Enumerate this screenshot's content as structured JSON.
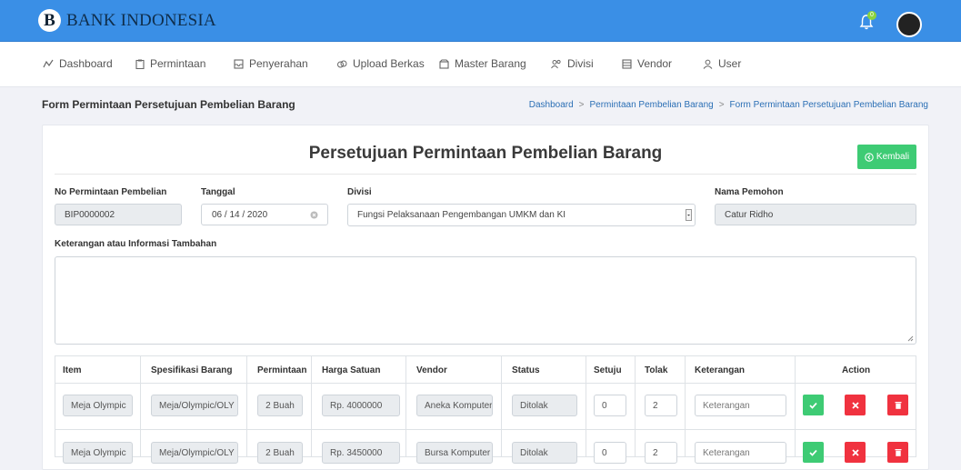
{
  "header": {
    "brand": "BANK INDONESIA",
    "logo_letter": "B",
    "notification_count": "0"
  },
  "nav": {
    "items": [
      "Dashboard",
      "Permintaan",
      "Penyerahan",
      "Upload Berkas",
      "Master Barang",
      "Divisi",
      "Vendor",
      "User"
    ]
  },
  "page": {
    "title": "Form Permintaan Persetujuan Pembelian Barang",
    "breadcrumb": [
      "Dashboard",
      "Permintaan Pembelian Barang",
      "Form Permintaan Persetujuan Pembelian Barang"
    ],
    "breadcrumb_sep": ">"
  },
  "form": {
    "heading": "Persetujuan Permintaan Pembelian Barang",
    "back_button": "Kembali",
    "no_label": "No Permintaan Pembelian",
    "no_value": "BIP0000002",
    "tanggal_label": "Tanggal",
    "tanggal_value": "06 / 14 / 2020",
    "divisi_label": "Divisi",
    "divisi_value": "Fungsi Pelaksanaan Pengembangan UMKM dan KI",
    "pemohon_label": "Nama Pemohon",
    "pemohon_value": "Catur Ridho",
    "keterangan_label": "Keterangan atau Informasi Tambahan"
  },
  "table": {
    "headers": [
      "Item",
      "Spesifikasi Barang",
      "Permintaan",
      "Harga Satuan",
      "Vendor",
      "Status",
      "Setuju",
      "Tolak",
      "Keterangan",
      "Action"
    ],
    "rows": [
      {
        "item": "Meja Olympic",
        "spec": "Meja/Olympic/OLY",
        "qty": "2 Buah",
        "price": "Rp. 4000000",
        "vendor": "Aneka Komputer",
        "status": "Ditolak",
        "setuju": "0",
        "tolak": "2",
        "keterangan_placeholder": "Keterangan"
      },
      {
        "item": "Meja Olympic",
        "spec": "Meja/Olympic/OLY",
        "qty": "2 Buah",
        "price": "Rp. 3450000",
        "vendor": "Bursa Komputer",
        "status": "Ditolak",
        "setuju": "0",
        "tolak": "2",
        "keterangan_placeholder": "Keterangan"
      }
    ]
  },
  "colors": {
    "topbar": "#3a8fe6",
    "success": "#3ecb74",
    "danger": "#f0323f"
  }
}
